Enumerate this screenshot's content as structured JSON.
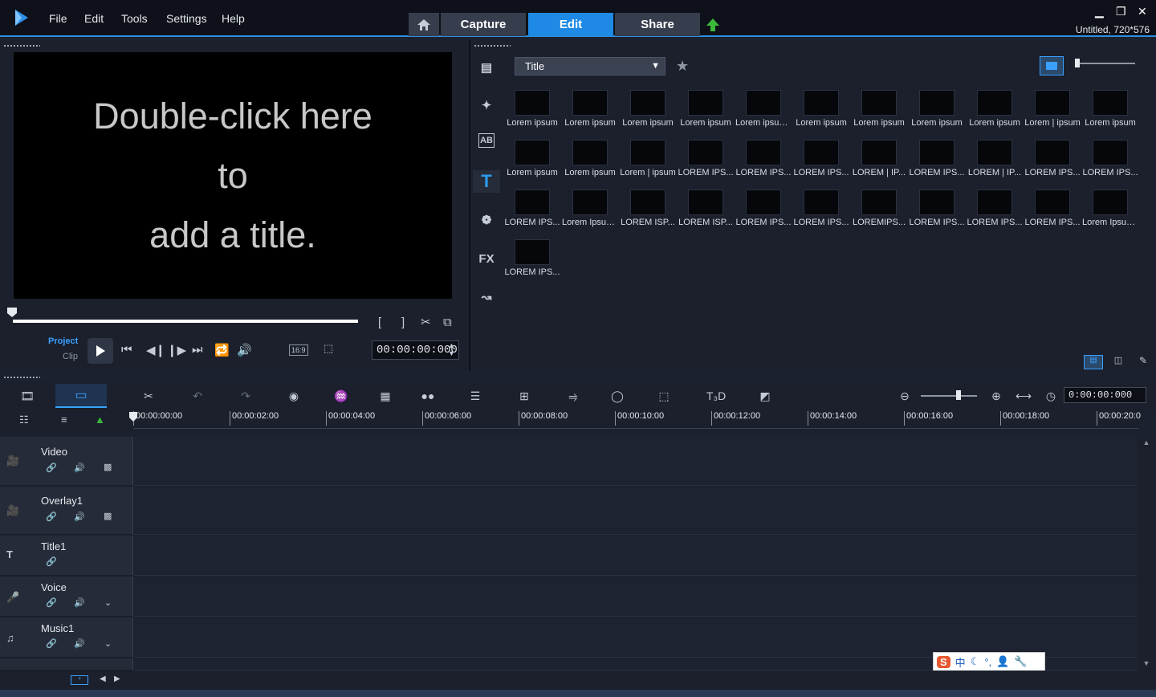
{
  "menu": {
    "file": "File",
    "edit": "Edit",
    "tools": "Tools",
    "settings": "Settings",
    "help": "Help"
  },
  "nav": {
    "capture": "Capture",
    "edit": "Edit",
    "share": "Share"
  },
  "project_info": "Untitled, 720*576",
  "preview": {
    "lines": [
      "Double-click here",
      "to",
      "add a title."
    ],
    "project_label": "Project",
    "clip_label": "Clip",
    "aspect": "16:9",
    "timecode": "00:00:00:000"
  },
  "library": {
    "dropdown": "Title",
    "items": [
      "Lorem ipsum",
      "Lorem ipsum",
      "Lorem ipsum",
      "Lorem ipsum",
      "Lorem ipsum...",
      "Lorem ipsum",
      "Lorem ipsum",
      "Lorem ipsum",
      "Lorem ipsum",
      "Lorem | ipsum",
      "Lorem ipsum",
      "Lorem ipsum",
      "Lorem ipsum",
      "Lorem | ipsum",
      "LOREM IPS...",
      "LOREM IPS...",
      "LOREM IPS...",
      "LOREM | IP...",
      "LOREM IPS...",
      "LOREM | IP...",
      "LOREM IPS...",
      "LOREM IPS...",
      "LOREM IPS...",
      "Lorem Ipsum...",
      "LOREM ISP...",
      "LOREM ISP...",
      "LOREM IPS...",
      "LOREM IPS...",
      "LOREMIPS...",
      "LOREM IPS...",
      "LOREM IPS...",
      "LOREM IPS...",
      "Lorem Ipsum...",
      "LOREM IPS..."
    ]
  },
  "timeline": {
    "timecode": "0:00:00:000",
    "ruler": [
      "00:00:00:00",
      "00:00:02:00",
      "00:00:04:00",
      "00:00:06:00",
      "00:00:08:00",
      "00:00:10:00",
      "00:00:12:00",
      "00:00:14:00",
      "00:00:16:00",
      "00:00:18:00",
      "00:00:20:0"
    ],
    "tracks": [
      "Video",
      "Overlay1",
      "Title1",
      "Voice",
      "Music1"
    ]
  },
  "ime": "中"
}
